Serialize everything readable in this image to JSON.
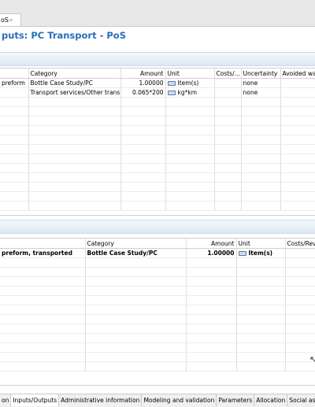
{
  "editor_tab": {
    "label": "oS",
    "close": "⌗"
  },
  "page_title": "puts: PC Transport - PoS",
  "inputs_table": {
    "headers": [
      "",
      "Category",
      "Amount",
      "Unit",
      "Costs/...",
      "Uncertainty",
      "Avoided wa"
    ],
    "rows": [
      [
        "preform",
        "Bottle Case Study/PC",
        "1.00000",
        "Item(s)",
        "",
        "none",
        ""
      ],
      [
        "",
        "Transport services/Other trans...",
        "0.065*200",
        "kg*km",
        "",
        "none",
        ""
      ]
    ]
  },
  "outputs_table": {
    "headers": [
      "",
      "Category",
      "Amount",
      "Unit",
      "Costs/Rev"
    ],
    "rows": [
      [
        "preform, transported",
        "Bottle Case Study/PC",
        "1.00000",
        "Item(s)",
        ""
      ]
    ]
  },
  "bottom_tabs": [
    "on",
    "Inputs/Outputs",
    "Administrative information",
    "Modeling and validation",
    "Parameters",
    "Allocation",
    "Social aspects"
  ],
  "active_bottom_tab": "Inputs/Outputs",
  "colors": {
    "title": "#2a6ebb",
    "section_bar": "#dce8f4"
  }
}
